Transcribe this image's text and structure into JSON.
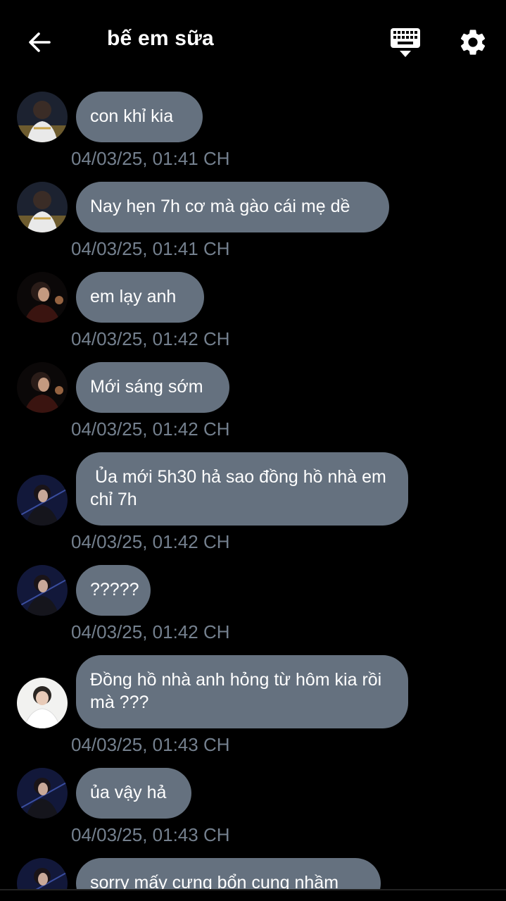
{
  "header": {
    "title": "bế em sữa",
    "back_icon": "arrow-left-icon",
    "keyboard_icon": "keyboard-icon",
    "settings_icon": "gear-icon"
  },
  "colors": {
    "background": "#000000",
    "bubble": "#65717f",
    "timestamp": "#74808e",
    "text": "#ffffff"
  },
  "messages": [
    {
      "text": "con khỉ kia",
      "time": "04/03/25, 01:41 CH",
      "avatar": "avatar-a"
    },
    {
      "text": "Nay hẹn 7h cơ mà gào cái mẹ dề",
      "time": "04/03/25, 01:41 CH",
      "avatar": "avatar-a"
    },
    {
      "text": "em lạy anh",
      "time": "04/03/25, 01:42 CH",
      "avatar": "avatar-b"
    },
    {
      "text": "Mới sáng sớm",
      "time": "04/03/25, 01:42 CH",
      "avatar": "avatar-b"
    },
    {
      "text": " Ủa mới 5h30 hả sao đồng hồ nhà em chỉ 7h",
      "time": "04/03/25, 01:42 CH",
      "avatar": "avatar-c"
    },
    {
      "text": "?????",
      "time": "04/03/25, 01:42 CH",
      "avatar": "avatar-c"
    },
    {
      "text": "Đồng hồ nhà anh hỏng từ hôm kia rồi mà ???",
      "time": "04/03/25, 01:43 CH",
      "avatar": "avatar-d"
    },
    {
      "text": "ủa vậy hả",
      "time": "04/03/25, 01:43 CH",
      "avatar": "avatar-c"
    },
    {
      "text": "sorry mấy cưng bổn cung nhầm",
      "time": "",
      "avatar": "avatar-c"
    }
  ]
}
